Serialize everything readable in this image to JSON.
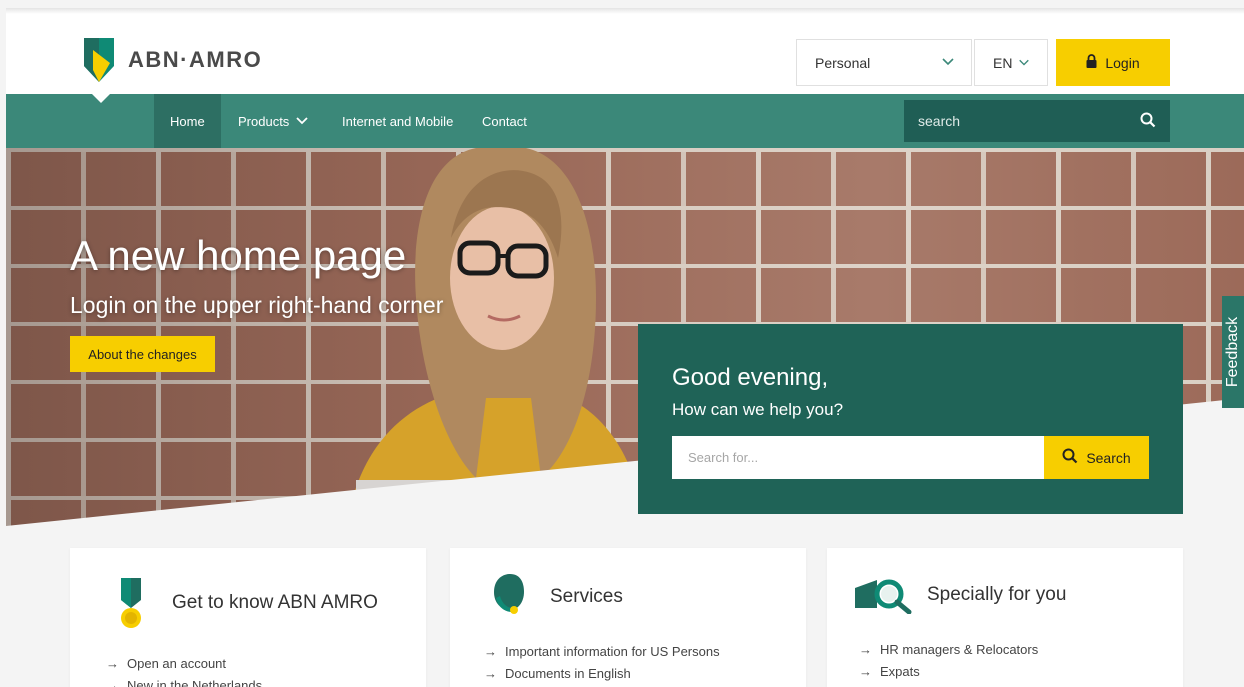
{
  "header": {
    "brand": "ABN·AMRO",
    "segment_value": "Personal",
    "language": "EN",
    "login_label": "Login"
  },
  "nav": {
    "items": [
      {
        "label": "Home"
      },
      {
        "label": "Products"
      },
      {
        "label": "Internet and Mobile"
      },
      {
        "label": "Contact"
      }
    ],
    "search_placeholder": "search"
  },
  "hero": {
    "title": "A new home page",
    "subtitle": "Login on the upper right-hand corner",
    "button_label": "About the changes"
  },
  "help": {
    "greeting": "Good evening,",
    "question": "How can we help you?",
    "search_placeholder": "Search for...",
    "search_button": "Search"
  },
  "feedback_label": "Feedback",
  "cards": [
    {
      "title": "Get to know ABN AMRO",
      "icon": "medal-icon",
      "links": [
        "Open an account",
        "New in the Netherlands"
      ]
    },
    {
      "title": "Services",
      "icon": "advisor-headset-icon",
      "links": [
        "Important information for US Persons",
        "Documents in English"
      ]
    },
    {
      "title": "Specially for you",
      "icon": "magnifier-icon",
      "links": [
        "HR managers & Relocators",
        "Expats"
      ]
    }
  ],
  "colors": {
    "brand_green": "#3b8879",
    "dark_green": "#1f6357",
    "accent_yellow": "#f7ce00"
  }
}
